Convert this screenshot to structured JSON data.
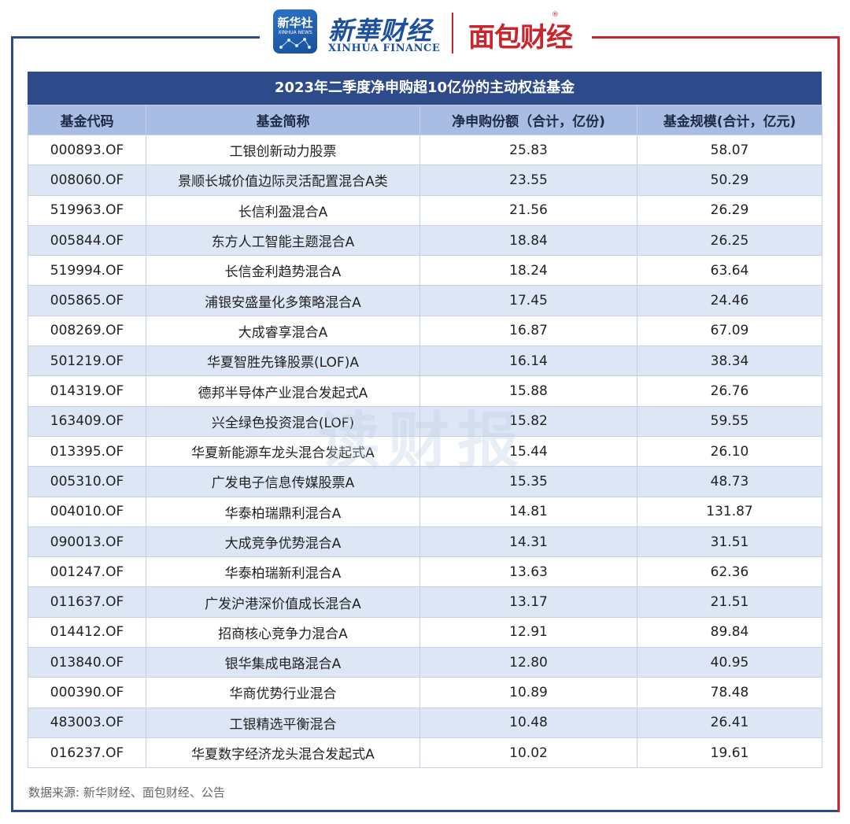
{
  "header": {
    "badge_text": "新华社",
    "badge_sub": "XINHUA NEWS",
    "brand_cn": "新華财经",
    "brand_en": "XINHUA FINANCE",
    "brand_partner": "面包财经",
    "registered_mark": "®"
  },
  "table": {
    "title": "2023年二季度净申购超10亿份的主动权益基金",
    "columns": [
      "基金代码",
      "基金简称",
      "净申购份额（合计，亿份)",
      "基金规模(合计，亿元)"
    ],
    "rows": [
      [
        "000893.OF",
        "工银创新动力股票",
        "25.83",
        "58.07"
      ],
      [
        "008060.OF",
        "景顺长城价值边际灵活配置混合A类",
        "23.55",
        "50.29"
      ],
      [
        "519963.OF",
        "长信利盈混合A",
        "21.56",
        "26.29"
      ],
      [
        "005844.OF",
        "东方人工智能主题混合A",
        "18.84",
        "26.25"
      ],
      [
        "519994.OF",
        "长信金利趋势混合A",
        "18.24",
        "63.64"
      ],
      [
        "005865.OF",
        "浦银安盛量化多策略混合A",
        "17.45",
        "24.46"
      ],
      [
        "008269.OF",
        "大成睿享混合A",
        "16.87",
        "67.09"
      ],
      [
        "501219.OF",
        "华夏智胜先锋股票(LOF)A",
        "16.14",
        "38.34"
      ],
      [
        "014319.OF",
        "德邦半导体产业混合发起式A",
        "15.88",
        "26.76"
      ],
      [
        "163409.OF",
        "兴全绿色投资混合(LOF)",
        "15.82",
        "59.55"
      ],
      [
        "013395.OF",
        "华夏新能源车龙头混合发起式A",
        "15.44",
        "26.10"
      ],
      [
        "005310.OF",
        "广发电子信息传媒股票A",
        "15.35",
        "48.73"
      ],
      [
        "004010.OF",
        "华泰柏瑞鼎利混合A",
        "14.81",
        "131.87"
      ],
      [
        "090013.OF",
        "大成竞争优势混合A",
        "14.31",
        "31.51"
      ],
      [
        "001247.OF",
        "华泰柏瑞新利混合A",
        "13.63",
        "62.36"
      ],
      [
        "011637.OF",
        "广发沪港深价值成长混合A",
        "13.17",
        "21.51"
      ],
      [
        "014412.OF",
        "招商核心竞争力混合A",
        "12.91",
        "89.84"
      ],
      [
        "013840.OF",
        "银华集成电路混合A",
        "12.80",
        "40.95"
      ],
      [
        "000390.OF",
        "华商优势行业混合",
        "10.89",
        "78.48"
      ],
      [
        "483003.OF",
        "工银精选平衡混合",
        "10.48",
        "26.41"
      ],
      [
        "016237.OF",
        "华夏数字经济龙头混合发起式A",
        "10.02",
        "19.61"
      ]
    ]
  },
  "watermark": "读财报",
  "source": "数据来源: 新华财经、面包财经、公告",
  "colors": {
    "header_blue": "#2d4a8a",
    "column_header": "#a9bde4",
    "row_alt": "#dde6f5",
    "accent_red": "#c9252c"
  }
}
